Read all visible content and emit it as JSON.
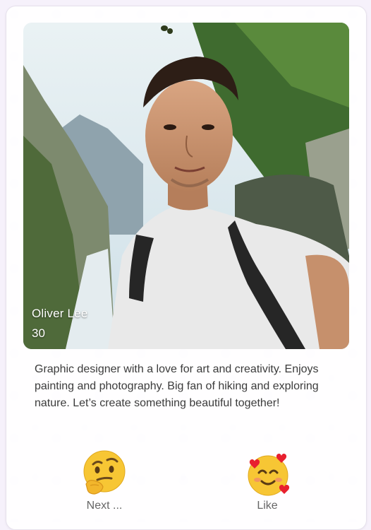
{
  "profile": {
    "name": "Oliver Lee",
    "age": "30",
    "bio": "Graphic designer with a love for art and creativity. Enjoys painting and photography. Big fan of hiking and exploring nature. Let’s create something beautiful together!"
  },
  "actions": {
    "next_label": "Next ...",
    "next_icon": "thinking-face-icon",
    "like_label": "Like",
    "like_icon": "smiling-face-with-hearts-icon"
  },
  "colors": {
    "background": "#f6f1fb",
    "card": "#ffffff",
    "text": "#3b3b3b",
    "muted": "#666666"
  }
}
